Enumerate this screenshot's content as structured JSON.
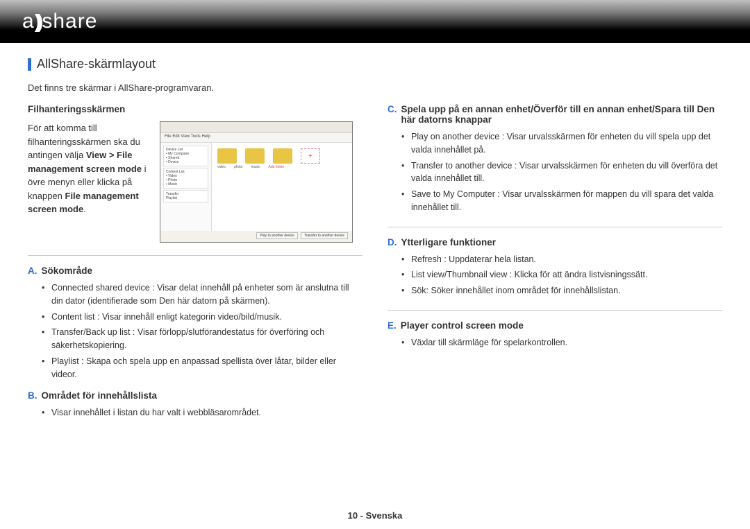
{
  "logo_text": "allshare",
  "section_title": "AllShare-skärmlayout",
  "intro": "Det finns tre skärmar i AllShare-programvaran.",
  "left": {
    "sub_head": "Filhanteringsskärmen",
    "para_pre": "För att komma till filhanteringsskärmen ska du antingen välja ",
    "para_b1": "View > File management screen mode",
    "para_mid": " i övre menyn eller klicka på knappen ",
    "para_b2": "File management screen mode",
    "para_end": ".",
    "ss_menu": "File  Edit  View  Tools  Help",
    "A": {
      "letter": "A.",
      "title": "Sökområde",
      "items": [
        "Connected shared device : Visar delat innehåll på enheter som är anslutna till din dator (identifierade som Den här datorn på skärmen).",
        "Content list : Visar innehåll enligt kategorin video/bild/musik.",
        "Transfer/Back up list : Visar förlopp/slutförandestatus för överföring och säkerhetskopiering.",
        "Playlist : Skapa och spela upp en anpassad spellista över låtar, bilder eller videor."
      ]
    },
    "B": {
      "letter": "B.",
      "title": "Området för innehållslista",
      "items": [
        "Visar innehållet i listan du har valt i webbläsarområdet."
      ]
    }
  },
  "right": {
    "C": {
      "letter": "C.",
      "title": "Spela upp på en annan enhet/Överför till en annan enhet/Spara till Den här datorns knappar",
      "items": [
        "Play on another device : Visar urvalsskärmen för enheten du vill spela upp det valda innehållet på.",
        "Transfer to another device : Visar urvalsskärmen för enheten du vill överföra det valda innehållet till.",
        "Save to My Computer : Visar urvalsskärmen för mappen du vill spara det valda innehållet till."
      ]
    },
    "D": {
      "letter": "D.",
      "title": "Ytterligare funktioner",
      "items": [
        "Refresh : Uppdaterar hela listan.",
        "List view/Thumbnail view : Klicka för att ändra listvisningssätt.",
        "Sök: Söker innehållet inom området för innehållslistan."
      ]
    },
    "E": {
      "letter": "E.",
      "title": "Player control screen mode",
      "items": [
        "Växlar till skärmläge för spelarkontrollen."
      ]
    }
  },
  "footer": "10 - Svenska"
}
